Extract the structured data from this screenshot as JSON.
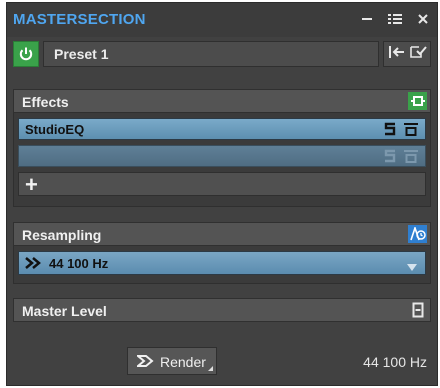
{
  "window": {
    "title": "MASTERSECTION",
    "controls": [
      "minimize-icon",
      "menu-icon",
      "close-icon"
    ]
  },
  "preset": {
    "power_state": "on",
    "name": "Preset 1",
    "actions": [
      "insert-icon",
      "save-preset-icon"
    ]
  },
  "effects": {
    "label": "Effects",
    "header_icon": "bypass-icon",
    "slots": [
      {
        "label": "StudioEQ",
        "active": true,
        "icons": [
          "solo-icon",
          "bypass-slot-icon"
        ]
      },
      {
        "label": "",
        "active": false,
        "icons": [
          "solo-icon",
          "bypass-slot-icon"
        ]
      }
    ],
    "add_label": "+"
  },
  "resampling": {
    "label": "Resampling",
    "header_icon": "resample-icon",
    "selected": "44 100 Hz"
  },
  "master_level": {
    "label": "Master Level",
    "header_icon": "meter-icon"
  },
  "footer": {
    "render_label": "Render",
    "sample_rate": "44 100 Hz"
  },
  "colors": {
    "accent_title": "#4fa6f0",
    "power_green": "#3aa24a",
    "bypass_green": "#3aa24a",
    "resample_blue": "#2f7fd0",
    "slot_active": "#6e9fc0"
  }
}
